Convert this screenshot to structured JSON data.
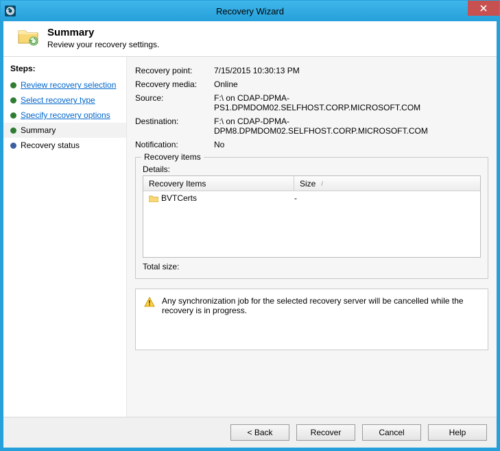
{
  "window": {
    "title": "Recovery Wizard"
  },
  "header": {
    "title": "Summary",
    "subtitle": "Review your recovery settings."
  },
  "steps": {
    "title": "Steps:",
    "items": [
      {
        "label": "Review recovery selection",
        "link": true,
        "bullet": "green"
      },
      {
        "label": "Select recovery type",
        "link": true,
        "bullet": "green"
      },
      {
        "label": "Specify recovery options",
        "link": true,
        "bullet": "green"
      },
      {
        "label": "Summary",
        "link": false,
        "bullet": "green",
        "current": true
      },
      {
        "label": "Recovery status",
        "link": false,
        "bullet": "blue"
      }
    ]
  },
  "details": {
    "recovery_point": {
      "label": "Recovery point:",
      "value": "7/15/2015 10:30:13 PM"
    },
    "recovery_media": {
      "label": "Recovery media:",
      "value": "Online"
    },
    "source": {
      "label": "Source:",
      "value": "F:\\ on CDAP-DPMA-PS1.DPMDOM02.SELFHOST.CORP.MICROSOFT.COM"
    },
    "destination": {
      "label": "Destination:",
      "value": "F:\\ on CDAP-DPMA-DPM8.DPMDOM02.SELFHOST.CORP.MICROSOFT.COM"
    },
    "notification": {
      "label": "Notification:",
      "value": "No"
    }
  },
  "recovery_items": {
    "legend": "Recovery items",
    "details_label": "Details:",
    "columns": {
      "name": "Recovery Items",
      "size": "Size"
    },
    "rows": [
      {
        "name": "BVTCerts",
        "size": "-"
      }
    ],
    "total_label": "Total size:",
    "total_value": ""
  },
  "warning": {
    "text": "Any synchronization job for the selected recovery server will be cancelled while the recovery is in progress."
  },
  "buttons": {
    "back": "< Back",
    "recover": "Recover",
    "cancel": "Cancel",
    "help": "Help"
  }
}
